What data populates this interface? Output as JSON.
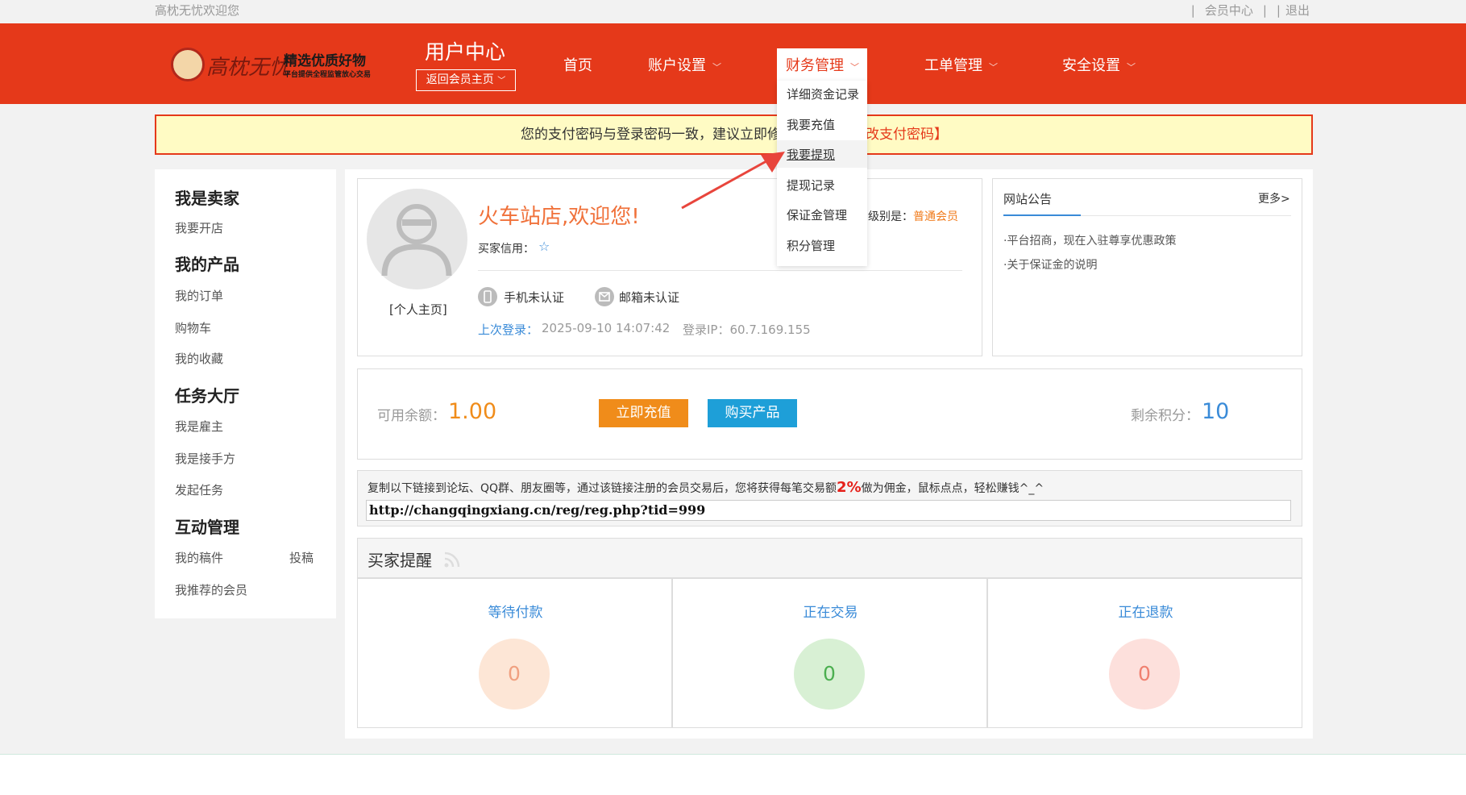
{
  "topbar": {
    "welcome": "高枕无忧欢迎您",
    "sep1": "|",
    "member_center": "会员中心",
    "sep2": "|",
    "sep3": "|",
    "logout": "退出"
  },
  "logo": {
    "brand": "高枕无忧",
    "slogan": "精选优质好物",
    "sub": "平台提供全程监管放心交易"
  },
  "header": {
    "title": "用户中心",
    "back_button": "返回会员主页",
    "nav": {
      "home": "首页",
      "account": "账户设置",
      "finance": "财务管理",
      "ticket": "工单管理",
      "security": "安全设置"
    }
  },
  "finance_dropdown": {
    "items": [
      "详细资金记录",
      "我要充值",
      "我要提现",
      "提现记录",
      "保证金管理",
      "积分管理"
    ]
  },
  "notice_bar": {
    "text1": "您的支付密码与登录密码一致，建议立即修",
    "text2": "改支付密码】"
  },
  "sidebar": {
    "seller_title": "我是卖家",
    "open_shop": "我要开店",
    "products_title": "我的产品",
    "my_orders": "我的订单",
    "cart": "购物车",
    "favorites": "我的收藏",
    "tasks_title": "任务大厅",
    "employer": "我是雇主",
    "taker": "我是接手方",
    "publish_task": "发起任务",
    "interact_title": "互动管理",
    "my_drafts": "我的稿件",
    "submit": "投稿",
    "referred": "我推荐的会员"
  },
  "profile": {
    "home_link": "[个人主页]",
    "greeting": "火车站店,欢迎您!",
    "credit_label": "买家信用：",
    "level_label": "级别是：",
    "level_value": "普通会员",
    "phone_status": "手机未认证",
    "email_status": "邮箱未认证",
    "last_login_label": "上次登录：",
    "last_login_value": "2025-09-10 14:07:42",
    "login_ip": "登录IP：60.7.169.155"
  },
  "site_notice": {
    "title": "网站公告",
    "more": "更多>",
    "items": [
      "·平台招商，现在入驻尊享优惠政策",
      "·关于保证金的说明"
    ]
  },
  "balance": {
    "available_label": "可用余额：",
    "available_value": "1.00",
    "recharge_button": "立即充值",
    "buy_button": "购买产品",
    "points_label": "剩余积分：",
    "points_value": "10"
  },
  "referral": {
    "text_before": "复制以下链接到论坛、QQ群、朋友圈等，通过该链接注册的会员交易后，您将获得每笔交易额",
    "percent": "2%",
    "text_after": "做为佣金，鼠标点点，轻松赚钱^_^",
    "link": "http://changqingxiang.cn/reg/reg.php?tid=999"
  },
  "buyer_reminder": {
    "title": "买家提醒",
    "cells": [
      {
        "label": "等待付款",
        "count": "0",
        "bg": "#fde6d6",
        "fg": "#f0a080"
      },
      {
        "label": "正在交易",
        "count": "0",
        "bg": "#d8f0d4",
        "fg": "#4caf50"
      },
      {
        "label": "正在退款",
        "count": "0",
        "bg": "#fde0dc",
        "fg": "#f08070"
      }
    ]
  },
  "colors": {
    "header_red": "#e5391a",
    "accent_orange": "#f08c1a",
    "accent_blue": "#1e9fd8"
  }
}
